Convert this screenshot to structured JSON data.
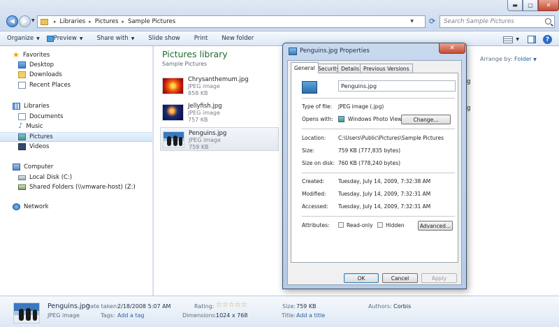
{
  "explorer": {
    "breadcrumb": [
      "Libraries",
      "Pictures",
      "Sample Pictures"
    ],
    "search_placeholder": "Search Sample Pictures",
    "toolbar": {
      "organize": "Organize",
      "preview": "Preview",
      "share_with": "Share with",
      "slide_show": "Slide show",
      "print": "Print",
      "new_folder": "New folder"
    },
    "nav": {
      "favorites": "Favorites",
      "desktop": "Desktop",
      "downloads": "Downloads",
      "recent_places": "Recent Places",
      "libraries": "Libraries",
      "documents": "Documents",
      "music": "Music",
      "pictures": "Pictures",
      "videos": "Videos",
      "computer": "Computer",
      "local_disk": "Local Disk (C:)",
      "shared_folders": "Shared Folders (\\\\vmware-host) (Z:)",
      "network": "Network"
    },
    "library": {
      "title": "Pictures library",
      "subtitle": "Sample Pictures",
      "arrange_label": "Arrange by:",
      "arrange_value": "Folder"
    },
    "files": [
      {
        "name": "Chrysanthemum.jpg",
        "type": "JPEG image",
        "size": "858 KB"
      },
      {
        "name": "Jellyfish.jpg",
        "type": "JPEG image",
        "size": "757 KB"
      },
      {
        "name": "Penguins.jpg",
        "type": "JPEG image",
        "size": "759 KB"
      }
    ],
    "details": {
      "name": "Penguins.jpg",
      "type": "JPEG image",
      "date_taken_label": "Date taken:",
      "date_taken": "2/18/2008 5:07 AM",
      "tags_label": "Tags:",
      "tags": "Add a tag",
      "rating_label": "Rating:",
      "rating_stars": "☆☆☆☆☆",
      "dimensions_label": "Dimensions:",
      "dimensions": "1024 x 768",
      "size_label": "Size:",
      "size": "759 KB",
      "title_label": "Title:",
      "title": "Add a title",
      "authors_label": "Authors:",
      "authors": "Corbis"
    }
  },
  "dialog": {
    "title": "Penguins.jpg Properties",
    "tabs": [
      "General",
      "Security",
      "Details",
      "Previous Versions"
    ],
    "filename": "Penguins.jpg",
    "type_label": "Type of file:",
    "type_value": "JPEG image (.jpg)",
    "opens_label": "Opens with:",
    "opens_value": "Windows Photo Viewer",
    "change_button": "Change...",
    "location_label": "Location:",
    "location_value": "C:\\Users\\Public\\Pictures\\Sample Pictures",
    "size_label": "Size:",
    "size_value": "759 KB (777,835 bytes)",
    "size_on_disk_label": "Size on disk:",
    "size_on_disk_value": "760 KB (778,240 bytes)",
    "created_label": "Created:",
    "created_value": "Tuesday, July 14, 2009, 7:32:38 AM",
    "modified_label": "Modified:",
    "modified_value": "Tuesday, July 14, 2009, 7:32:31 AM",
    "accessed_label": "Accessed:",
    "accessed_value": "Tuesday, July 14, 2009, 7:32:31 AM",
    "attributes_label": "Attributes:",
    "readonly_label": "Read-only",
    "hidden_label": "Hidden",
    "advanced_button": "Advanced...",
    "ok_button": "OK",
    "cancel_button": "Cancel",
    "apply_button": "Apply"
  }
}
